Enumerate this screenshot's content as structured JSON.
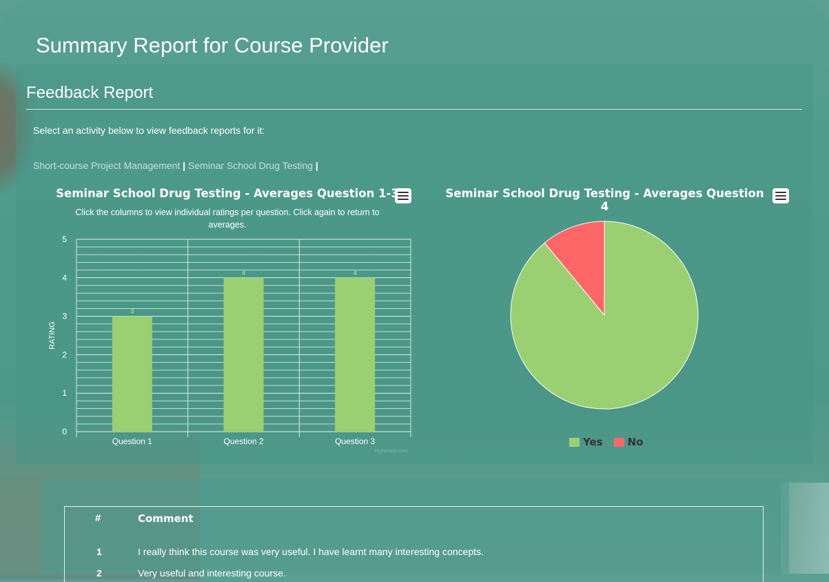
{
  "page": {
    "title": "Summary Report for Course Provider"
  },
  "feedback": {
    "title": "Feedback Report",
    "intro": "Select an activity below to view feedback reports for it:",
    "activities": [
      "Short-course Project Management",
      "Seminar School Drug Testing"
    ],
    "separator": "|"
  },
  "bar_chart": {
    "title": "Seminar School Drug Testing - Averages Question 1-3",
    "subtitle_line1": "Click the columns to view individual ratings per question. Click again to return to",
    "subtitle_line2": "averages.",
    "menu_icon": "hamburger-menu-icon",
    "credit": "Highcharts.com"
  },
  "pie_chart": {
    "title": "Seminar School Drug Testing - Averages Question 4",
    "menu_icon": "hamburger-menu-icon"
  },
  "comments": {
    "headers": {
      "number": "#",
      "comment": "Comment"
    },
    "rows": [
      {
        "number": "1",
        "text": "I really think this course was very useful. I have learnt many interesting concepts."
      },
      {
        "number": "2",
        "text": "Very useful and interesting course."
      }
    ]
  },
  "colors": {
    "bar": "#9ad072",
    "yes": "#9ad072",
    "no": "#ff6666",
    "background": "#4f9a8b"
  },
  "chart_data": [
    {
      "type": "bar",
      "title": "Seminar School Drug Testing - Averages Question 1-3",
      "subtitle": "Click the columns to view individual ratings per question. Click again to return to averages.",
      "categories": [
        "Question 1",
        "Question 2",
        "Question 3"
      ],
      "values": [
        3,
        4,
        4
      ],
      "data_labels": [
        "3",
        "4",
        "4"
      ],
      "xlabel": "",
      "ylabel": "RATING",
      "ylim": [
        0,
        5
      ],
      "yticks": [
        "0",
        "1",
        "2",
        "3",
        "4",
        "5"
      ],
      "grid": true
    },
    {
      "type": "pie",
      "title": "Seminar School Drug Testing - Averages Question 4",
      "labels": [
        "Yes",
        "No"
      ],
      "values": [
        89,
        11
      ],
      "legend": "bottom-center"
    }
  ]
}
